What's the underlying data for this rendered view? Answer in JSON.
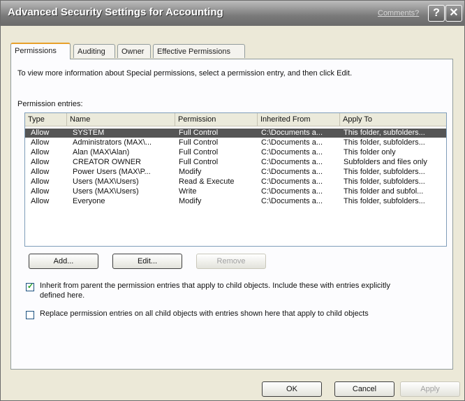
{
  "window": {
    "title": "Advanced Security Settings for Accounting",
    "comments_link": "Comments?",
    "help_label": "?",
    "close_label": "✕"
  },
  "tabs": [
    {
      "label": "Permissions",
      "active": true
    },
    {
      "label": "Auditing",
      "active": false
    },
    {
      "label": "Owner",
      "active": false
    },
    {
      "label": "Effective Permissions",
      "active": false
    }
  ],
  "instructions": "To view more information about Special permissions, select a permission entry, and then click Edit.",
  "permission_entries_label": "Permission entries:",
  "table": {
    "columns": [
      "Type",
      "Name",
      "Permission",
      "Inherited From",
      "Apply To"
    ],
    "rows": [
      [
        "Allow",
        "SYSTEM",
        "Full Control",
        "C:\\Documents a...",
        "This folder, subfolders..."
      ],
      [
        "Allow",
        "Administrators (MAX\\...",
        "Full Control",
        "C:\\Documents a...",
        "This folder, subfolders..."
      ],
      [
        "Allow",
        "Alan (MAX\\Alan)",
        "Full Control",
        "C:\\Documents a...",
        "This folder only"
      ],
      [
        "Allow",
        "CREATOR OWNER",
        "Full Control",
        "C:\\Documents a...",
        "Subfolders and files only"
      ],
      [
        "Allow",
        "Power Users (MAX\\P...",
        "Modify",
        "C:\\Documents a...",
        "This folder, subfolders..."
      ],
      [
        "Allow",
        "Users (MAX\\Users)",
        "Read & Execute",
        "C:\\Documents a...",
        "This folder, subfolders..."
      ],
      [
        "Allow",
        "Users (MAX\\Users)",
        "Write",
        "C:\\Documents a...",
        "This folder and subfol..."
      ],
      [
        "Allow",
        "Everyone",
        "Modify",
        "C:\\Documents a...",
        "This folder, subfolders..."
      ]
    ],
    "selected_row": 0
  },
  "buttons": {
    "add": "Add...",
    "edit": "Edit...",
    "remove": "Remove",
    "ok": "OK",
    "cancel": "Cancel",
    "apply": "Apply"
  },
  "inherit_checkbox": {
    "checked": true,
    "line1": "Inherit from parent the permission entries that apply to child objects. Include these with entries explicitly",
    "line2": "defined here."
  },
  "replace_checkbox": {
    "checked": false,
    "label": "Replace permission entries on all child objects with entries shown here that apply to child objects"
  }
}
